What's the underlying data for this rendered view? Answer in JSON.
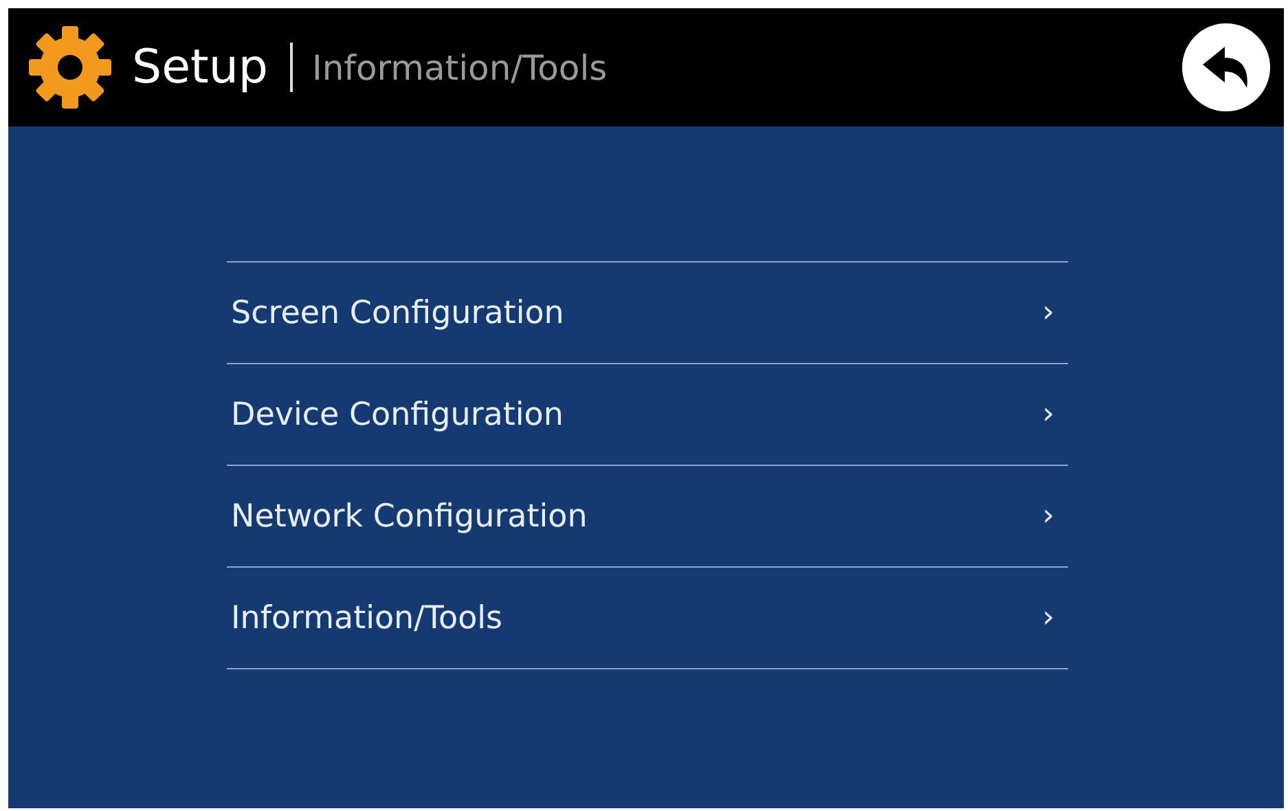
{
  "header": {
    "title": "Setup",
    "subtitle": "Information/Tools"
  },
  "menu": [
    {
      "label": "Screen Configuration",
      "chevron": "›"
    },
    {
      "label": "Device Configuration",
      "chevron": "›"
    },
    {
      "label": "Network Configuration",
      "chevron": "›"
    },
    {
      "label": "Information/Tools",
      "chevron": "›"
    }
  ]
}
